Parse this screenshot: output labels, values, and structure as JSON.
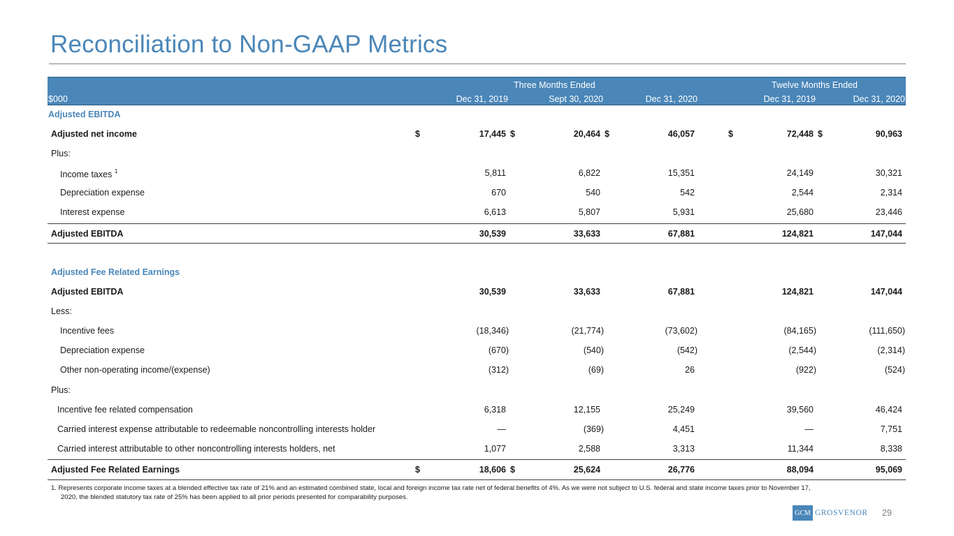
{
  "title": "Reconciliation to Non-GAAP Metrics",
  "header": {
    "group_three": "Three Months Ended",
    "group_twelve": "Twelve Months Ended",
    "unit": "$000",
    "cols": [
      "Dec 31, 2019",
      "Sept 30, 2020",
      "Dec 31, 2020",
      "Dec 31, 2019",
      "Dec 31, 2020"
    ]
  },
  "ebitda_section": {
    "heading": "Adjusted EBITDA",
    "rows": [
      {
        "label": "Adjusted net income",
        "values": [
          "17,445",
          "20,464",
          "46,057",
          "72,448",
          "90,963"
        ]
      },
      {
        "label": "Plus:"
      },
      {
        "label": "Income taxes",
        "footnote_ref": "1",
        "values": [
          "5,811",
          "6,822",
          "15,351",
          "24,149",
          "30,321"
        ]
      },
      {
        "label": "Depreciation expense",
        "values": [
          "670",
          "540",
          "542",
          "2,544",
          "2,314"
        ]
      },
      {
        "label": "Interest expense",
        "values": [
          "6,613",
          "5,807",
          "5,931",
          "25,680",
          "23,446"
        ]
      },
      {
        "label": "Adjusted EBITDA",
        "values": [
          "30,539",
          "33,633",
          "67,881",
          "124,821",
          "147,044"
        ]
      }
    ]
  },
  "fre_section": {
    "heading": "Adjusted Fee Related Earnings",
    "rows": [
      {
        "label": "Adjusted EBITDA",
        "values": [
          "30,539",
          "33,633",
          "67,881",
          "124,821",
          "147,044"
        ]
      },
      {
        "label": "Less:"
      },
      {
        "label": "Incentive fees",
        "values": [
          "(18,346)",
          "(21,774)",
          "(73,602)",
          "(84,165)",
          "(111,650)"
        ]
      },
      {
        "label": "Depreciation expense",
        "values": [
          "(670)",
          "(540)",
          "(542)",
          "(2,544)",
          "(2,314)"
        ]
      },
      {
        "label": "Other non-operating income/(expense)",
        "values": [
          "(312)",
          "(69)",
          "26",
          "(922)",
          "(524)"
        ]
      },
      {
        "label": "Plus:"
      },
      {
        "label": "Incentive fee related compensation",
        "values": [
          "6,318",
          "12,155",
          "25,249",
          "39,560",
          "46,424"
        ]
      },
      {
        "label": "Carried interest expense attributable to redeemable noncontrolling interests holder",
        "values": [
          "—",
          "(369)",
          "4,451",
          "—",
          "7,751"
        ]
      },
      {
        "label": "Carried interest attributable to other noncontrolling interests holders, net",
        "values": [
          "1,077",
          "2,588",
          "3,313",
          "11,344",
          "8,338"
        ]
      },
      {
        "label": "Adjusted Fee Related Earnings",
        "values": [
          "18,606",
          "25,624",
          "26,776",
          "88,094",
          "95,069"
        ]
      }
    ]
  },
  "currency_symbol": "$",
  "footnote": {
    "line1": "1. Represents corporate income taxes at a blended effective tax rate of 21% and an estimated combined state, local and foreign income tax rate net of federal benefits of 4%. As we were not subject to U.S. federal and state income taxes prior to November 17,",
    "line2": "2020, the blended statutory tax rate of 25% has been applied to all prior periods presented for comparability purposes."
  },
  "logo": {
    "mark": "GCM",
    "word": "GROSVENOR"
  },
  "page_number": "29",
  "colors": {
    "accent": "#4a86b8"
  }
}
